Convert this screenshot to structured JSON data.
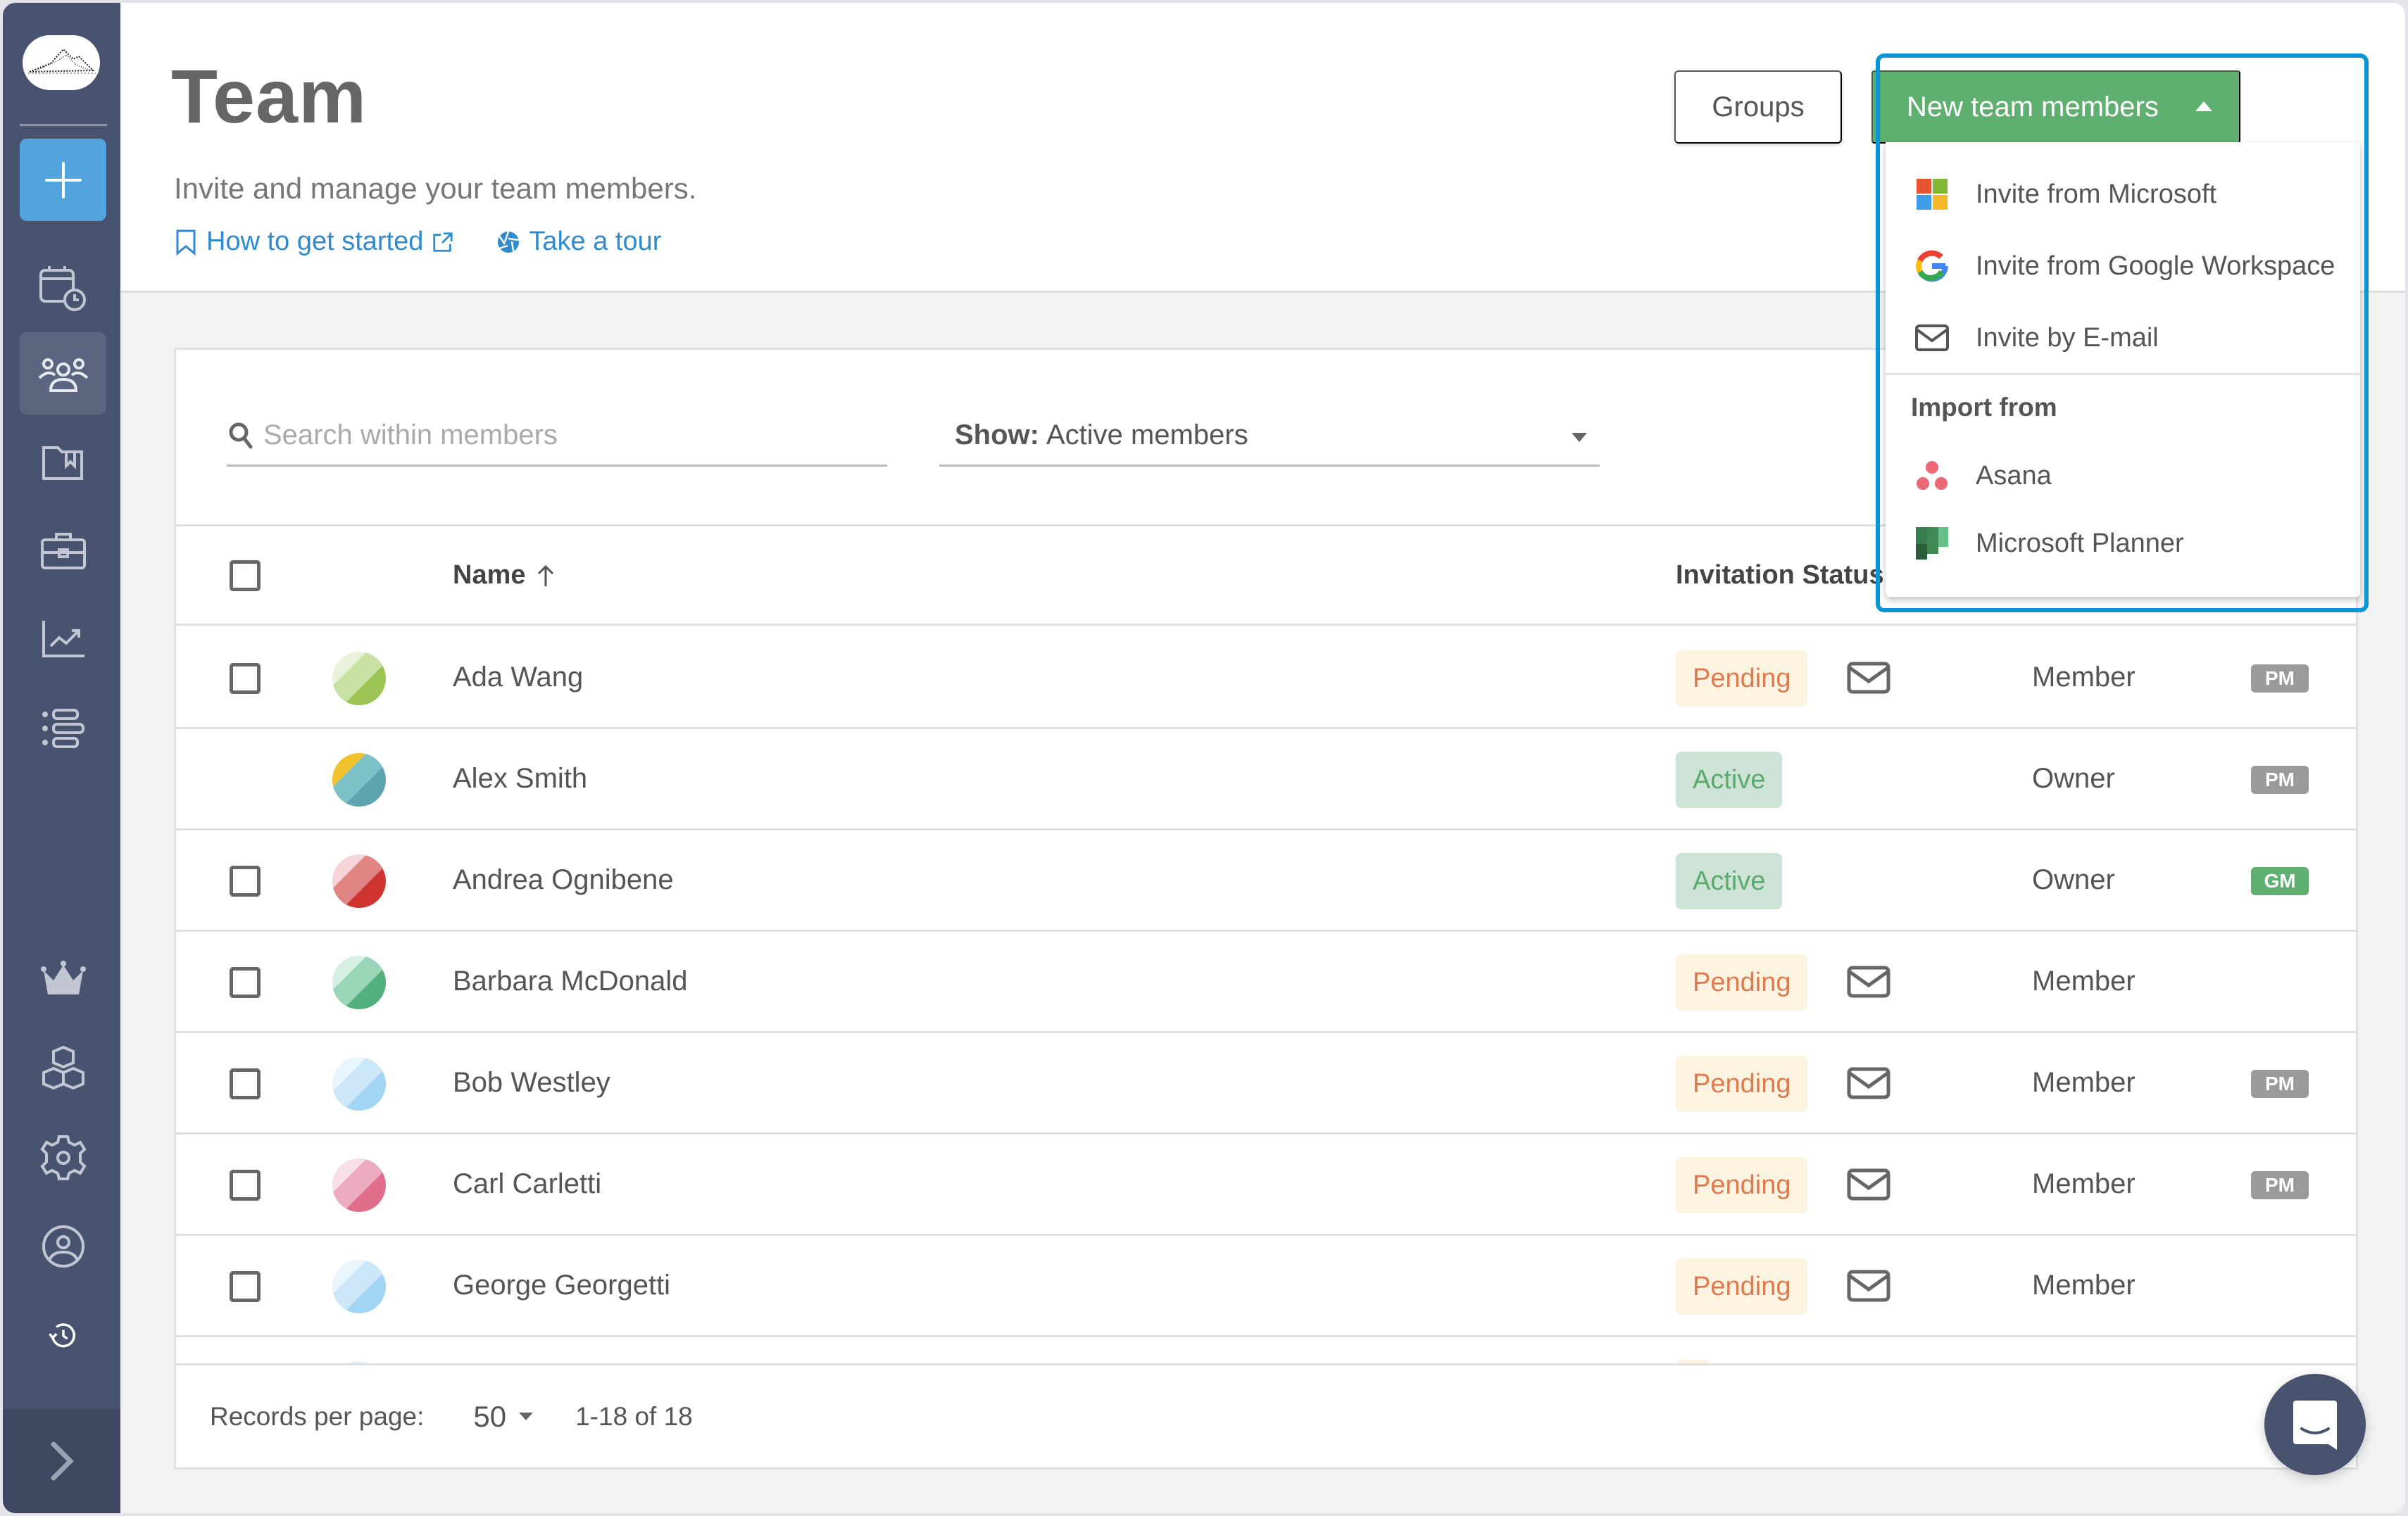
{
  "sidebar": {
    "items": [
      {
        "name": "calendar-clock",
        "label": "Planning"
      },
      {
        "name": "team",
        "label": "Team",
        "active": true
      },
      {
        "name": "projects-folder",
        "label": "Projects"
      },
      {
        "name": "clients-briefcase",
        "label": "Clients"
      },
      {
        "name": "reports-chart",
        "label": "Reports"
      },
      {
        "name": "list-view",
        "label": "List"
      },
      {
        "name": "crown",
        "label": "Upgrade"
      },
      {
        "name": "integrations-cubes",
        "label": "Integrations"
      },
      {
        "name": "settings-gear",
        "label": "Settings"
      },
      {
        "name": "profile",
        "label": "Profile"
      },
      {
        "name": "history",
        "label": "History"
      }
    ],
    "add_label": "+",
    "expand_label": ">"
  },
  "header": {
    "title": "Team",
    "subtitle": "Invite and manage your team members.",
    "links": {
      "get_started": "How to get started",
      "tour": "Take a tour"
    },
    "groups_button": "Groups",
    "new_members_button": "New team members"
  },
  "dropdown": {
    "items": [
      {
        "icon": "microsoft-icon",
        "label": "Invite from Microsoft"
      },
      {
        "icon": "google-icon",
        "label": "Invite from Google Workspace"
      },
      {
        "icon": "email-icon",
        "label": "Invite by E-mail"
      }
    ],
    "import_section_label": "Import from",
    "import_items": [
      {
        "icon": "asana-icon",
        "label": "Asana"
      },
      {
        "icon": "microsoft-planner-icon",
        "label": "Microsoft Planner"
      }
    ]
  },
  "filters": {
    "search_placeholder": "Search within members",
    "search_value": "",
    "show_label": "Show:",
    "show_value": "Active members"
  },
  "table": {
    "columns": {
      "name": "Name",
      "invitation_status": "Invitation Status"
    },
    "sort": {
      "column": "Name",
      "direction": "ascending"
    },
    "rows": [
      {
        "name": "Ada Wang",
        "status": "Pending",
        "role": "Member",
        "tag": "PM",
        "has_checkbox": true,
        "has_mail": true,
        "avatar_colors": [
          "#9bc455",
          "#c8e2a3",
          "#e8f3da"
        ]
      },
      {
        "name": "Alex Smith",
        "status": "Active",
        "role": "Owner",
        "tag": "PM",
        "has_checkbox": false,
        "has_mail": false,
        "avatar_colors": [
          "#5ea4ad",
          "#7cc0c8",
          "#f2c12e"
        ]
      },
      {
        "name": "Andrea Ognibene",
        "status": "Active",
        "role": "Owner",
        "tag": "GM",
        "has_checkbox": true,
        "has_mail": false,
        "avatar_colors": [
          "#cf3430",
          "#e18584",
          "#f5d5d7"
        ]
      },
      {
        "name": "Barbara McDonald",
        "status": "Pending",
        "role": "Member",
        "tag": "",
        "has_checkbox": true,
        "has_mail": true,
        "avatar_colors": [
          "#52b07d",
          "#98d6b7",
          "#d6f0e3"
        ]
      },
      {
        "name": "Bob Westley",
        "status": "Pending",
        "role": "Member",
        "tag": "PM",
        "has_checkbox": true,
        "has_mail": true,
        "avatar_colors": [
          "#a2d4f3",
          "#cbe6f8",
          "#e9f5fc"
        ]
      },
      {
        "name": "Carl Carletti",
        "status": "Pending",
        "role": "Member",
        "tag": "PM",
        "has_checkbox": true,
        "has_mail": true,
        "avatar_colors": [
          "#e06d8b",
          "#edacc0",
          "#f7dfe6"
        ]
      },
      {
        "name": "George Georgetti",
        "status": "Pending",
        "role": "Member",
        "tag": "",
        "has_checkbox": true,
        "has_mail": true,
        "avatar_colors": [
          "#a2d4f3",
          "#cbe6f8",
          "#e9f5fc"
        ]
      }
    ]
  },
  "pagination": {
    "records_per_page_label": "Records per page:",
    "records_per_page": "50",
    "range": "1-18 of 18"
  },
  "colors": {
    "sidebar": "#48536f",
    "accent_blue": "#52a4dd",
    "primary_green": "#5faf70",
    "link_blue": "#2f8ad0",
    "highlight_border": "#0a96d6",
    "pending_text": "#e07a4f",
    "pending_bg": "#fdf3e1",
    "active_text": "#5aaa6c",
    "active_bg": "#cce3d6"
  }
}
